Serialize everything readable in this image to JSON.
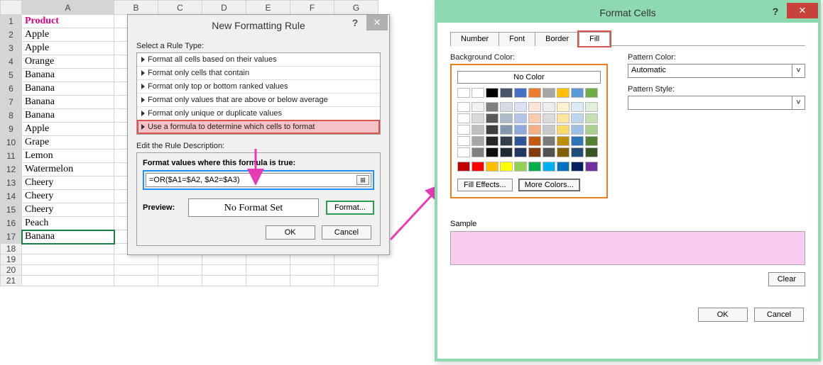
{
  "sheet": {
    "columns": [
      "A",
      "B",
      "C",
      "D",
      "E",
      "F",
      "G"
    ],
    "header": "Product",
    "rows": [
      "Apple",
      "Apple",
      "Orange",
      "Banana",
      "Banana",
      "Banana",
      "Banana",
      "Apple",
      "Grape",
      "Lemon",
      "Watermelon",
      "Cheery",
      "Cheery",
      "Cheery",
      "Peach",
      "Banana"
    ],
    "row_count": 21
  },
  "dlg1": {
    "title": "New Formatting Rule",
    "help": "?",
    "close": "✕",
    "select_label": "Select a Rule Type:",
    "rules": [
      "Format all cells based on their values",
      "Format only cells that contain",
      "Format only top or bottom ranked values",
      "Format only values that are above or below average",
      "Format only unique or duplicate values",
      "Use a formula to determine which cells to format"
    ],
    "selected_rule_index": 5,
    "edit_label": "Edit the Rule Description:",
    "formula_label": "Format values where this formula is true:",
    "formula": "=OR($A1=$A2, $A2=$A3)",
    "preview_label": "Preview:",
    "preview_text": "No Format Set",
    "format_btn": "Format...",
    "ok": "OK",
    "cancel": "Cancel"
  },
  "dlg2": {
    "title": "Format Cells",
    "help": "?",
    "close": "✕",
    "tabs": [
      "Number",
      "Font",
      "Border",
      "Fill"
    ],
    "active_tab_index": 3,
    "bgcolor_label": "Background Color:",
    "nocolor": "No Color",
    "theme_row": [
      "#ffffff",
      "#000000",
      "#44546a",
      "#4472c4",
      "#ed7d31",
      "#a5a5a5",
      "#ffc000",
      "#5b9bd5",
      "#70ad47"
    ],
    "theme_tints": [
      [
        "#f2f2f2",
        "#7f7f7f",
        "#d6dce5",
        "#d9e1f2",
        "#fce4d6",
        "#ededed",
        "#fff2cc",
        "#ddebf7",
        "#e2efda"
      ],
      [
        "#d9d9d9",
        "#595959",
        "#acb9ca",
        "#b4c6e7",
        "#f8cbad",
        "#dbdbdb",
        "#ffe699",
        "#bdd7ee",
        "#c6e0b4"
      ],
      [
        "#bfbfbf",
        "#404040",
        "#8497b0",
        "#8ea9db",
        "#f4b084",
        "#c9c9c9",
        "#ffd966",
        "#9bc2e6",
        "#a9d08e"
      ],
      [
        "#a6a6a6",
        "#262626",
        "#333f4f",
        "#305496",
        "#c65911",
        "#7b7b7b",
        "#bf8f00",
        "#2f75b5",
        "#548235"
      ],
      [
        "#808080",
        "#0d0d0d",
        "#222b35",
        "#203764",
        "#833c0c",
        "#525252",
        "#806000",
        "#1f4e78",
        "#375623"
      ]
    ],
    "std_row": [
      "#c00000",
      "#ff0000",
      "#ffc000",
      "#ffff00",
      "#92d050",
      "#00b050",
      "#00b0f0",
      "#0070c0",
      "#002060",
      "#7030a0"
    ],
    "fill_effects": "Fill Effects...",
    "more_colors": "More Colors...",
    "pattern_color_label": "Pattern Color:",
    "pattern_color_value": "Automatic",
    "pattern_style_label": "Pattern Style:",
    "sample_label": "Sample",
    "sample_color": "#f9caf0",
    "clear": "Clear",
    "ok": "OK",
    "cancel": "Cancel"
  }
}
